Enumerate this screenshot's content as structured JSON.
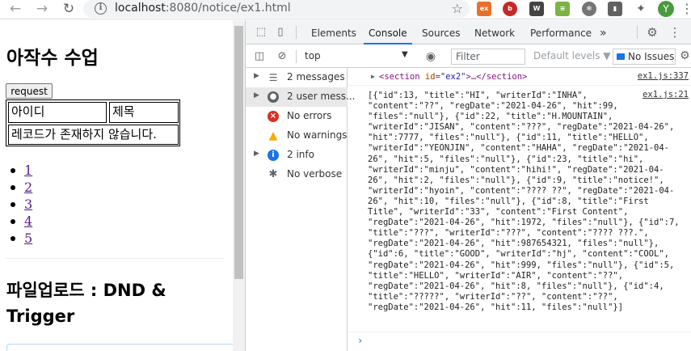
{
  "browser": {
    "url_host": "localhost",
    "url_path": ":8080/notice/ex1.html",
    "avatar_letter": "Y"
  },
  "page": {
    "title": "아작수 수업",
    "request_button": "request",
    "table": {
      "headers": [
        "아이디",
        "제목"
      ],
      "empty_message": "레코드가 존재하지 않습니다."
    },
    "pager": [
      "1",
      "2",
      "3",
      "4",
      "5"
    ],
    "heading2": "파일업로드 : DND & Trigger"
  },
  "devtools": {
    "tabs": [
      "Elements",
      "Console",
      "Sources",
      "Network",
      "Performance"
    ],
    "active_tab": "Console",
    "more_tabs": "»",
    "context": "top",
    "filter_placeholder": "Filter",
    "levels": "Default levels ▼",
    "issues": "No Issues",
    "sidebar": [
      {
        "label": "2 messages",
        "icon": "list-icon",
        "expandable": true
      },
      {
        "label": "2 user mess...",
        "icon": "user-icon",
        "expandable": true,
        "selected": true
      },
      {
        "label": "No errors",
        "icon": "error-icon",
        "expandable": false
      },
      {
        "label": "No warnings",
        "icon": "warning-icon",
        "expandable": false
      },
      {
        "label": "2 info",
        "icon": "info-icon",
        "expandable": true
      },
      {
        "label": "No verbose",
        "icon": "bug-icon",
        "expandable": false
      }
    ],
    "console": {
      "row1_open": "<section",
      "row1_attr": "id",
      "row1_val": "\"ex2\"",
      "row1_rest": ">…</section>",
      "row1_link": "ex1.js:337",
      "row2_link": "ex1.js:21",
      "json_lines": [
        "[{\"id\":13, \"title\":\"HI\", \"writerId\":\"INHA\",",
        "\"content\":\"??\", \"regDate\":\"2021-04-26\", \"hit\":99,",
        "\"files\":\"null\"}, {\"id\":22, \"title\":\"H.MOUNTAIN\",",
        "\"writerId\":\"JISAN\", \"content\":\"???\", \"regDate\":\"2021-04-26\",",
        "\"hit\":7777, \"files\":\"null\"}, {\"id\":11, \"title\":\"HELLO\",",
        "\"writerId\":\"YEONJIN\", \"content\":\"HAHA\", \"regDate\":\"2021-04-",
        "26\", \"hit\":5, \"files\":\"null\"}, {\"id\":23, \"title\":\"hi\",",
        "\"writerId\":\"minju\", \"content\":\"hihi!\", \"regDate\":\"2021-04-",
        "26\", \"hit\":2, \"files\":\"null\"}, {\"id\":9, \"title\":\"notice!\",",
        "\"writerId\":\"hyoin\", \"content\":\"???? ??\", \"regDate\":\"2021-04-",
        "26\", \"hit\":10, \"files\":\"null\"}, {\"id\":8, \"title\":\"First",
        "Title\", \"writerId\":\"33\", \"content\":\"First Content\",",
        "\"regDate\":\"2021-04-26\", \"hit\":1972, \"files\":\"null\"}, {\"id\":7,",
        "\"title\":\"???\", \"writerId\":\"???\", \"content\":\"???? ???.\",",
        "\"regDate\":\"2021-04-26\", \"hit\":987654321, \"files\":\"null\"},",
        "{\"id\":6, \"title\":\"GOOD\", \"writerId\":\"hj\", \"content\":\"COOL\",",
        "\"regDate\":\"2021-04-26\", \"hit\":999, \"files\":\"null\"}, {\"id\":5,",
        "\"title\":\"HELLO\", \"writerId\":\"AIR\", \"content\":\"??\",",
        "\"regDate\":\"2021-04-26\", \"hit\":8, \"files\":\"null\"}, {\"id\":4,",
        "\"title\":\"?????\", \"writerId\":\"??\", \"content\":\"??\",",
        "\"regDate\":\"2021-04-26\", \"hit\":11, \"files\":\"null\"}]"
      ],
      "prompt": "›"
    }
  }
}
